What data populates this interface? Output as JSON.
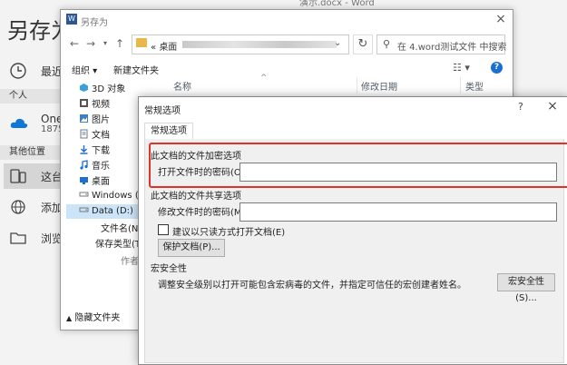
{
  "backstage": {
    "title": "另存为",
    "recent": "最近",
    "personal_header": "个人",
    "onedrive": "One",
    "onedrive_sub": "1875",
    "other_header": "其他位置",
    "this_pc": "这台",
    "add_place": "添加",
    "browse": "浏览",
    "doc_title": "演示.docx - Word",
    "close_icon": "×"
  },
  "saveas": {
    "title": "另存为",
    "address": {
      "prefix": "«",
      "folder": "桌面"
    },
    "search_placeholder": "在 4.word测试文件 中搜索",
    "toolbar": {
      "organize": "组织 ▾",
      "new_folder": "新建文件夹"
    },
    "nav_items": [
      {
        "label": "3D 对象",
        "icon": "3d-objects-icon",
        "color": "#3aa0d8"
      },
      {
        "label": "视频",
        "icon": "video-icon",
        "color": "#555555"
      },
      {
        "label": "图片",
        "icon": "pictures-icon",
        "color": "#3b7fc4"
      },
      {
        "label": "文档",
        "icon": "documents-icon",
        "color": "#6b7c8c"
      },
      {
        "label": "下载",
        "icon": "download-icon",
        "color": "#1a6fd1"
      },
      {
        "label": "音乐",
        "icon": "music-icon",
        "color": "#1a6fd1"
      },
      {
        "label": "桌面",
        "icon": "desktop-icon",
        "color": "#1a6fd1"
      },
      {
        "label": "Windows (C:)",
        "icon": "drive-icon",
        "color": "#777777"
      },
      {
        "label": "Data (D:)",
        "icon": "drive-icon",
        "color": "#777777",
        "selected": true
      }
    ],
    "columns": {
      "name": "名称",
      "modified": "修改日期",
      "type": "类型"
    },
    "filename_label": "文件名(N):",
    "filetype_label": "保存类型(T):",
    "author_label": "作者:",
    "hide_folders": "隐藏文件夹"
  },
  "general_options": {
    "title": "常规选项",
    "help": "?",
    "close": "×",
    "tab": "常规选项",
    "encryption_header": "此文档的文件加密选项",
    "open_password_label": "打开文件时的密码(O):",
    "open_password_value": "",
    "sharing_header": "此文档的文件共享选项",
    "modify_password_label": "修改文件时的密码(M):",
    "modify_password_value": "",
    "readonly_label": "建议以只读方式打开文档(E)",
    "readonly_checked": false,
    "protect_button": "保护文档(P)...",
    "macro_header": "宏安全性",
    "macro_desc": "调整安全级别以打开可能包含宏病毒的文件，并指定可信任的宏创建者姓名。",
    "macro_button": "宏安全性(S)...",
    "highlight_color": "#d9352a"
  }
}
